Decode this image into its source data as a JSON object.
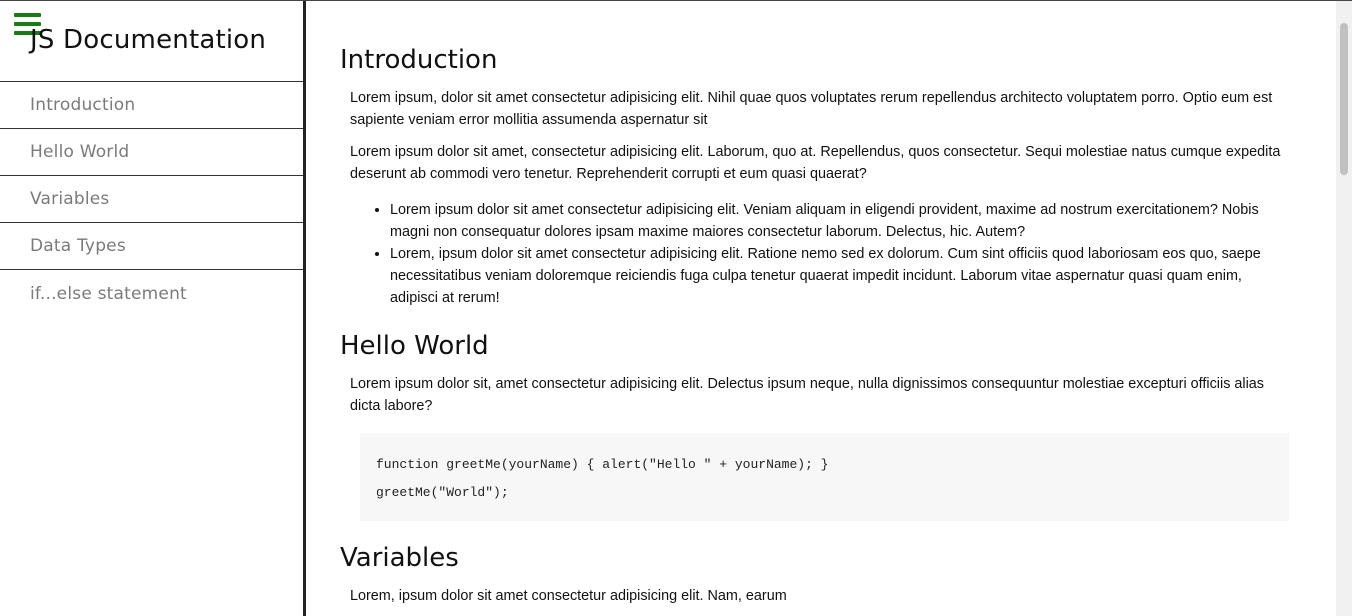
{
  "sidebar": {
    "title": "JS Documentation",
    "items": [
      {
        "label": "Introduction"
      },
      {
        "label": "Hello World"
      },
      {
        "label": "Variables"
      },
      {
        "label": "Data Types"
      },
      {
        "label": "if...else statement"
      }
    ]
  },
  "icons": {
    "menu": "hamburger-menu-icon",
    "menu_color": "#1a7a1a"
  },
  "main": {
    "intro": {
      "title": "Introduction",
      "p1": "Lorem ipsum, dolor sit amet consectetur adipisicing elit. Nihil quae quos voluptates rerum repellendus architecto voluptatem porro. Optio eum est sapiente veniam error mollitia assumenda aspernatur sit",
      "p2": "Lorem ipsum dolor sit amet, consectetur adipisicing elit. Laborum, quo at. Repellendus, quos consectetur. Sequi molestiae natus cumque expedita deserunt ab commodi vero tenetur. Reprehenderit corrupti et eum quasi quaerat?",
      "bullets": [
        "Lorem ipsum dolor sit amet consectetur adipisicing elit. Veniam aliquam in eligendi provident, maxime ad nostrum exercitationem? Nobis magni non consequatur dolores ipsam maxime maiores consectetur laborum. Delectus, hic. Autem?",
        "Lorem, ipsum dolor sit amet consectetur adipisicing elit. Ratione nemo sed ex dolorum. Cum sint officiis quod laboriosam eos quo, saepe necessitatibus veniam doloremque reiciendis fuga culpa tenetur quaerat impedit incidunt. Laborum vitae aspernatur quasi quam enim, adipisci at rerum!"
      ]
    },
    "hello": {
      "title": "Hello World",
      "p1": "Lorem ipsum dolor sit, amet consectetur adipisicing elit. Delectus ipsum neque, nulla dignissimos consequuntur molestiae excepturi officiis alias dicta labore?",
      "code_line1": "function greetMe(yourName) { alert(\"Hello \" + yourName); }",
      "code_line2": "greetMe(\"World\");"
    },
    "vars": {
      "title": "Variables",
      "p1": "Lorem, ipsum dolor sit amet consectetur adipisicing elit. Nam, earum"
    }
  }
}
